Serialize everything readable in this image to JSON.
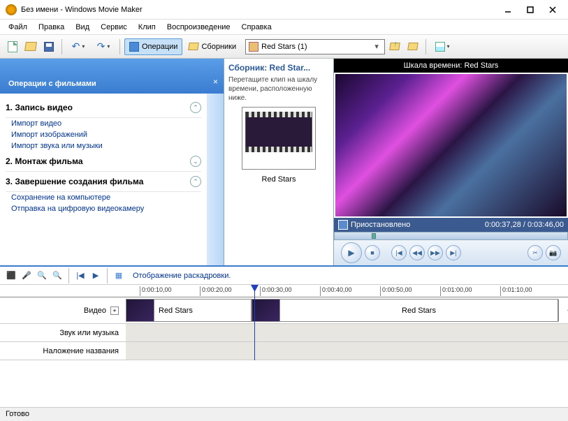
{
  "window": {
    "title": "Без имени - Windows Movie Maker"
  },
  "menu": {
    "file": "Файл",
    "edit": "Правка",
    "view": "Вид",
    "tools": "Сервис",
    "clip": "Клип",
    "play": "Воспроизведение",
    "help": "Справка"
  },
  "toolbar": {
    "operations": "Операции",
    "collections": "Сборники",
    "collection_selected": "Red Stars (1)"
  },
  "tasks": {
    "header": "Операции с фильмами",
    "s1": {
      "title": "1. Запись видео",
      "links": [
        "Импорт видео",
        "Импорт изображений",
        "Импорт звука или музыки"
      ]
    },
    "s2": {
      "title": "2. Монтаж фильма"
    },
    "s3": {
      "title": "3. Завершение создания фильма",
      "links": [
        "Сохранение на компьютере",
        "Отправка на цифровую видеокамеру"
      ]
    }
  },
  "collection": {
    "title": "Сборник: Red Star...",
    "desc": "Перетащите клип на шкалу времени, расположенную ниже.",
    "clip_label": "Red Stars"
  },
  "preview": {
    "title": "Шкала времени: Red Stars",
    "status": "Приостановлено",
    "timecode": "0:00:37,28 / 0:03:46,00"
  },
  "timeline": {
    "storyboard_link": "Отображение раскадровки.",
    "labels": {
      "video": "Видео",
      "audio": "Звук или музыка",
      "title": "Наложение названия"
    },
    "ticks": [
      "0:00:10,00",
      "0:00:20,00",
      "0:00:30,00",
      "0:00:40,00",
      "0:00:50,00",
      "0:01:00,00",
      "0:01:10,00"
    ],
    "clip1": "Red Stars",
    "clip2": "Red Stars"
  },
  "statusbar": {
    "text": "Готово"
  }
}
